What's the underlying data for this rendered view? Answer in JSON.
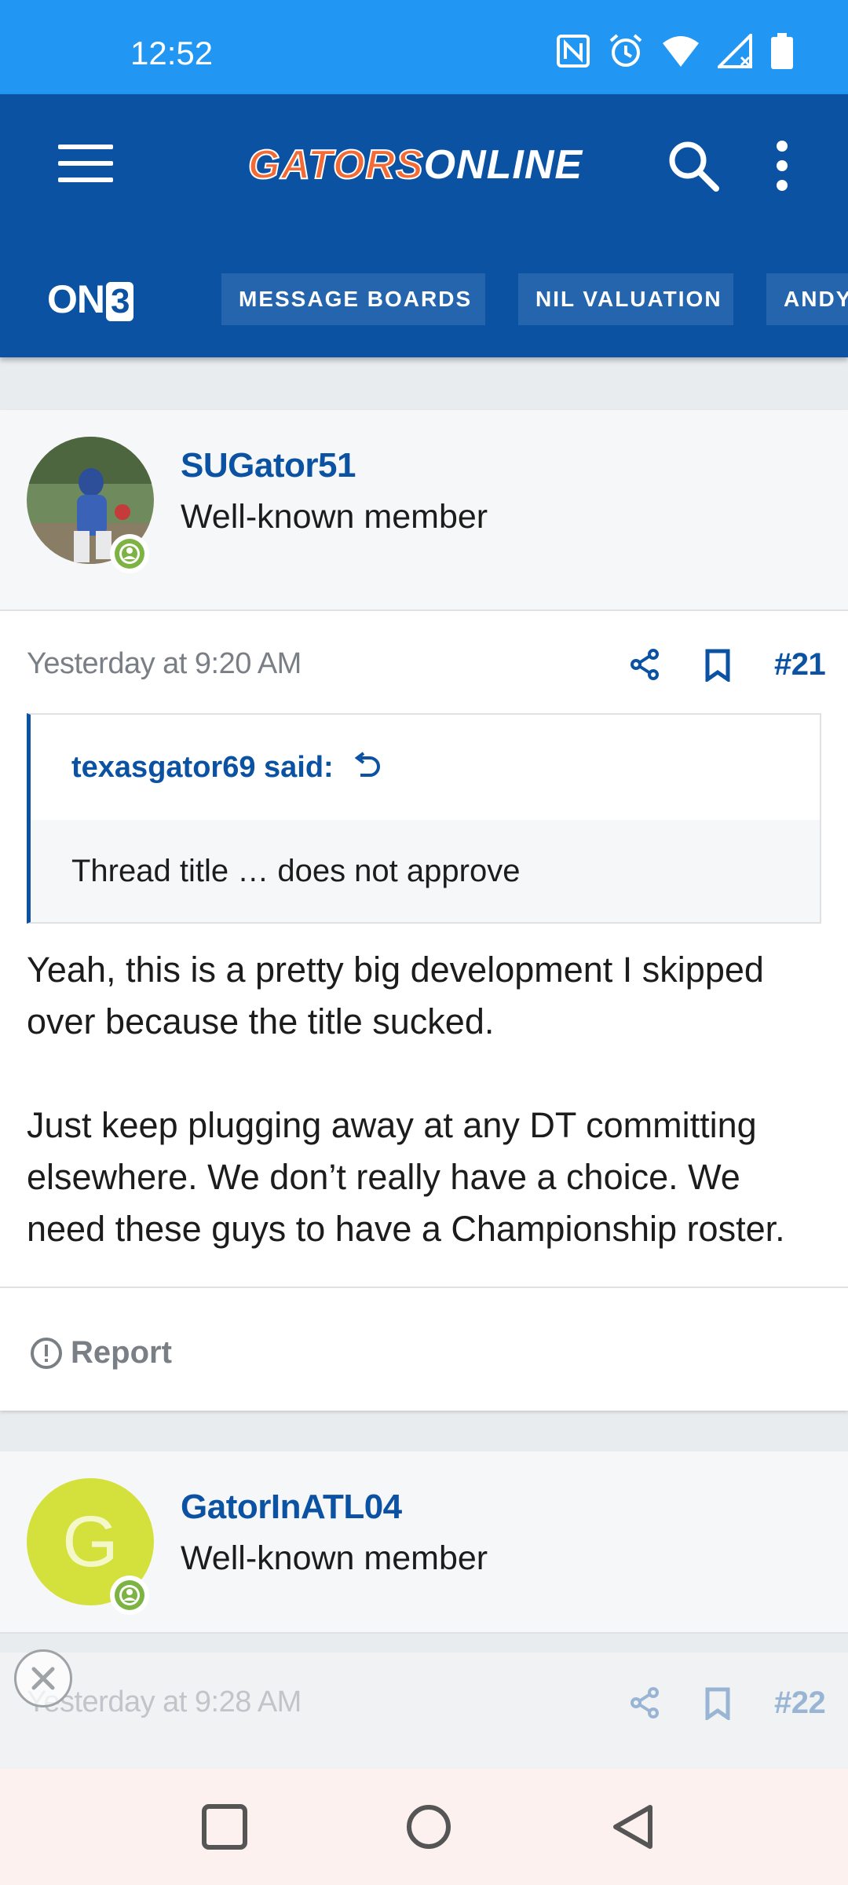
{
  "status_bar": {
    "time": "12:52",
    "icons": [
      "nfc-icon",
      "alarm-icon",
      "wifi-icon",
      "signal-icon",
      "battery-icon"
    ]
  },
  "app_bar": {
    "logo_part1": "GATORS",
    "logo_part2": "ONLINE",
    "brand_badge_text": "ON",
    "brand_badge_number": "3",
    "nav_tabs": [
      "MESSAGE BOARDS",
      "NIL VALUATION",
      "ANDY"
    ],
    "colors": {
      "primary": "#0b52a3",
      "status": "#2196f3",
      "logo_orange": "#f26b36"
    }
  },
  "post1": {
    "username": "SUGator51",
    "user_title": "Well-known member",
    "date": "Yesterday at 9:20 AM",
    "number": "#21",
    "quote_author": "texasgator69 said:",
    "quote_text": "Thread title … does not approve",
    "body_paragraph_1": "Yeah, this is a pretty big development I skipped over because the title sucked.",
    "body_paragraph_2": "Just keep plugging away at any DT committing elsewhere. We don’t really have a choice. We need these guys to have a Championship roster.",
    "report_label": "Report"
  },
  "post2": {
    "avatar_letter": "G",
    "avatar_color": "#d4e03c",
    "username": "GatorInATL04",
    "user_title": "Well-known member",
    "date": "Yesterday at 9:28 AM",
    "number": "#22"
  }
}
